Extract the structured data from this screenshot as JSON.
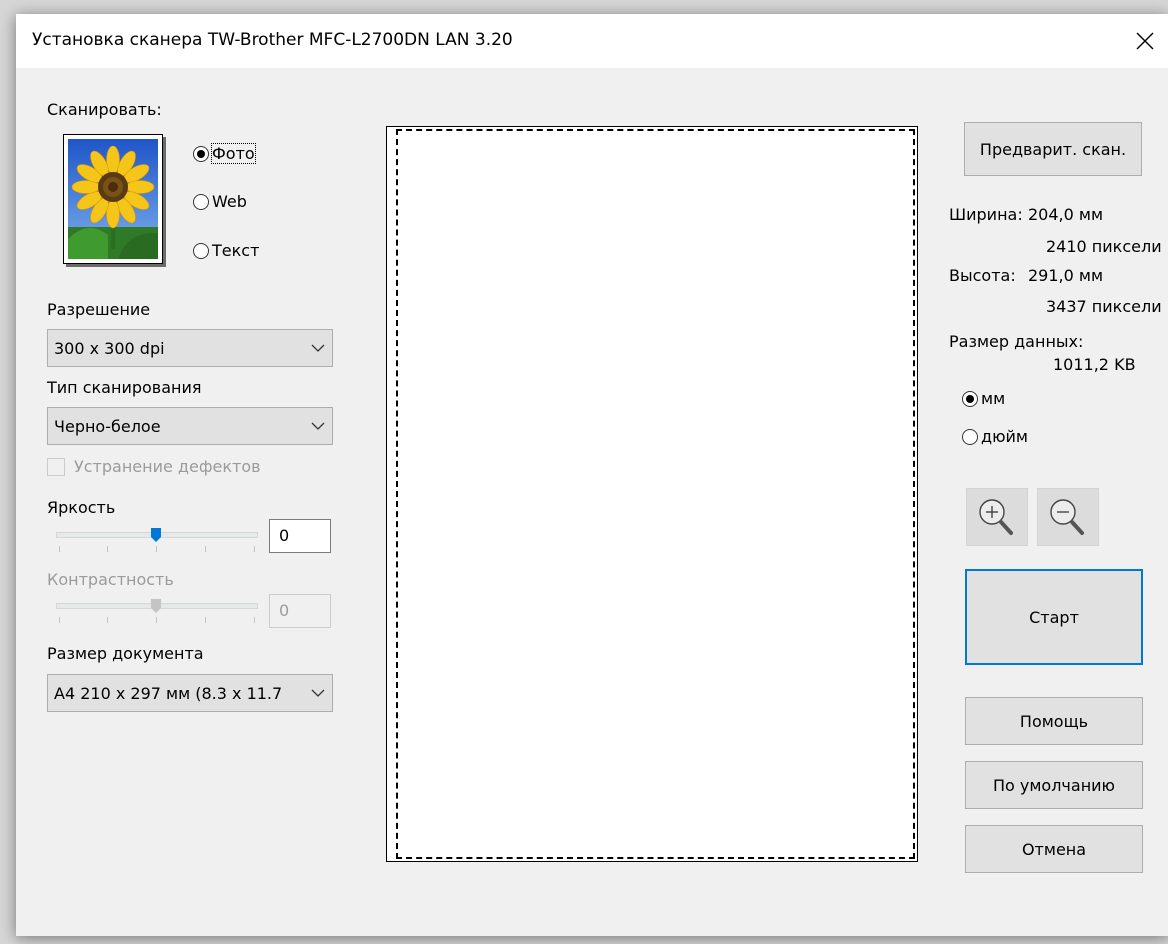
{
  "window": {
    "title": "Установка сканера TW-Brother MFC-L2700DN LAN 3.20",
    "close_glyph": "✕"
  },
  "scan_type": {
    "label": "Сканировать:",
    "options": [
      {
        "label": "Фото",
        "checked": true
      },
      {
        "label": "Web",
        "checked": false
      },
      {
        "label": "Текст",
        "checked": false
      }
    ],
    "thumbnail_icon": "sunflower-photo-icon"
  },
  "resolution": {
    "label": "Разрешение",
    "value": "300 x 300 dpi"
  },
  "scan_mode": {
    "label": "Тип сканирования",
    "value": "Черно-белое"
  },
  "despeckle": {
    "label": "Устранение дефектов",
    "checked": false,
    "enabled": false
  },
  "brightness": {
    "label": "Яркость",
    "value": "0",
    "level": 0.5
  },
  "contrast": {
    "label": "Контрастность",
    "value": "0",
    "level": 0.5,
    "enabled": false
  },
  "document_size": {
    "label": "Размер документа",
    "value": "A4 210 x 297 мм (8.3 x 11.7"
  },
  "actions": {
    "prescan": "Предварит. скан.",
    "start": "Старт",
    "help": "Помощь",
    "defaults": "По умолчанию",
    "cancel": "Отмена"
  },
  "info": {
    "width_label": "Ширина:",
    "width_mm": "204,0 мм",
    "width_px": "2410 пиксели",
    "height_label": "Высота:",
    "height_mm": "291,0 мм",
    "height_px": "3437 пиксели",
    "size_label": "Размер данных:",
    "size_value": "1011,2 KB"
  },
  "units": {
    "options": [
      {
        "label": "мм",
        "checked": true
      },
      {
        "label": "дюйм",
        "checked": false
      }
    ]
  },
  "zoom": {
    "in_icon": "zoom-in-icon",
    "out_icon": "zoom-out-icon"
  },
  "colors": {
    "accent": "#0078d7",
    "dialog_bg": "#f0f0f0",
    "button_bg": "#e1e1e1"
  }
}
